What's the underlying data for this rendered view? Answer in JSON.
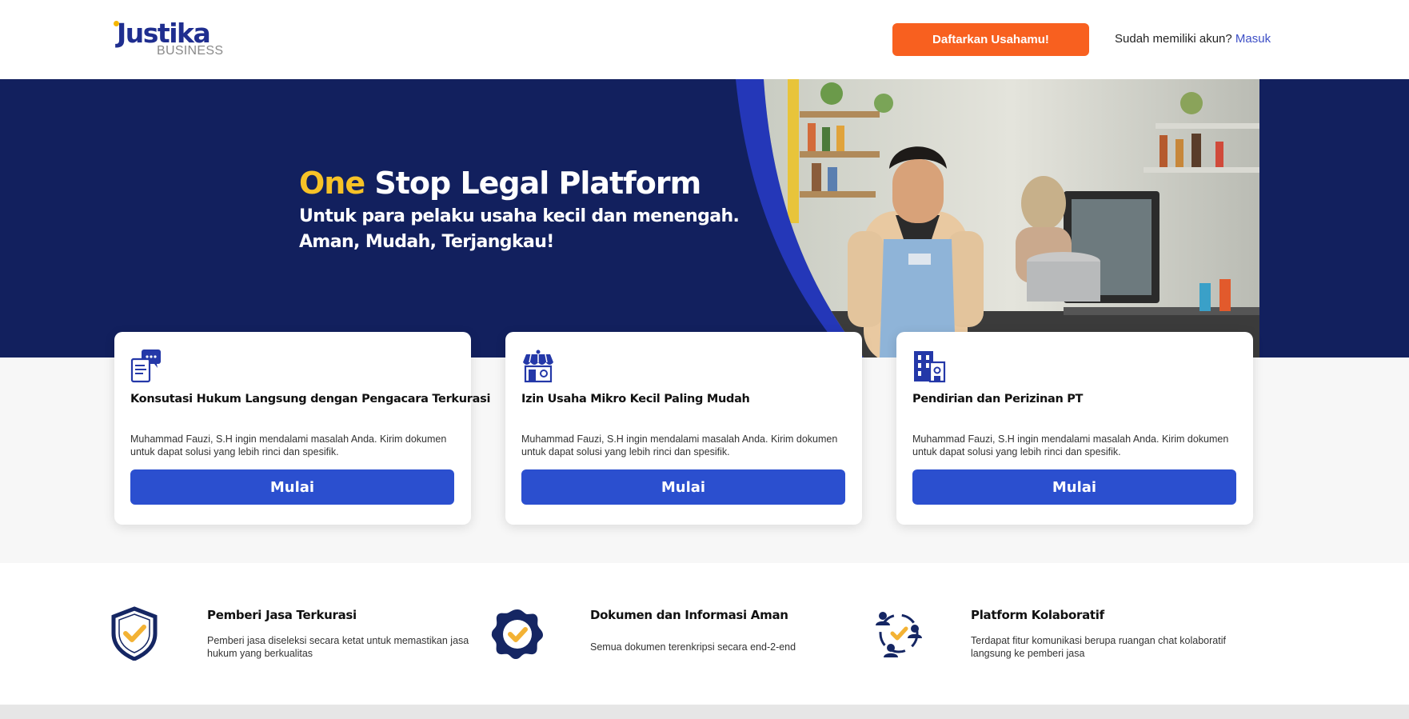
{
  "header": {
    "logo_text": "Justika",
    "logo_sub": "BUSINESS",
    "register_label": "Daftarkan Usahamu!",
    "login_prompt": "Sudah memiliki akun?",
    "login_link": "Masuk"
  },
  "hero": {
    "title_accent": "One",
    "title_rest": " Stop Legal Platform",
    "subtitle_line1": "Untuk para pelaku usaha kecil dan menengah.",
    "subtitle_line2": "Aman, Mudah, Terjangkau!"
  },
  "cards": [
    {
      "icon": "chat-document-icon",
      "title": "Konsutasi Hukum Langsung dengan Pengacara Terkurasi",
      "desc": "Muhammad Fauzi, S.H ingin mendalami masalah Anda. Kirim dokumen untuk dapat solusi yang lebih rinci dan spesifik.",
      "button": "Mulai"
    },
    {
      "icon": "storefront-icon",
      "title": "Izin Usaha Mikro Kecil Paling Mudah",
      "desc": "Muhammad Fauzi, S.H ingin mendalami masalah Anda. Kirim dokumen untuk dapat solusi yang lebih rinci dan spesifik.",
      "button": "Mulai"
    },
    {
      "icon": "office-building-icon",
      "title": "Pendirian dan Perizinan PT",
      "desc": "Muhammad Fauzi, S.H ingin mendalami masalah Anda. Kirim dokumen untuk dapat solusi yang lebih rinci dan spesifik.",
      "button": "Mulai"
    }
  ],
  "features": [
    {
      "icon": "shield-check-icon",
      "title": "Pemberi Jasa Terkurasi",
      "desc": "Pemberi jasa diseleksi secara ketat untuk memastikan jasa hukum yang berkualitas"
    },
    {
      "icon": "badge-check-icon",
      "title": "Dokumen dan Informasi Aman",
      "desc": "Semua dokumen terenkripsi secara end-2-end"
    },
    {
      "icon": "people-cycle-check-icon",
      "title": "Platform Kolaboratif",
      "desc": "Terdapat fitur komunikasi berupa ruangan chat kolaboratif langsung ke pemberi jasa"
    }
  ],
  "colors": {
    "navy": "#12205e",
    "accent_yellow": "#f7c227",
    "cta_orange": "#f8601f",
    "button_blue": "#2b4fcf",
    "link_blue": "#3d4fc6"
  }
}
